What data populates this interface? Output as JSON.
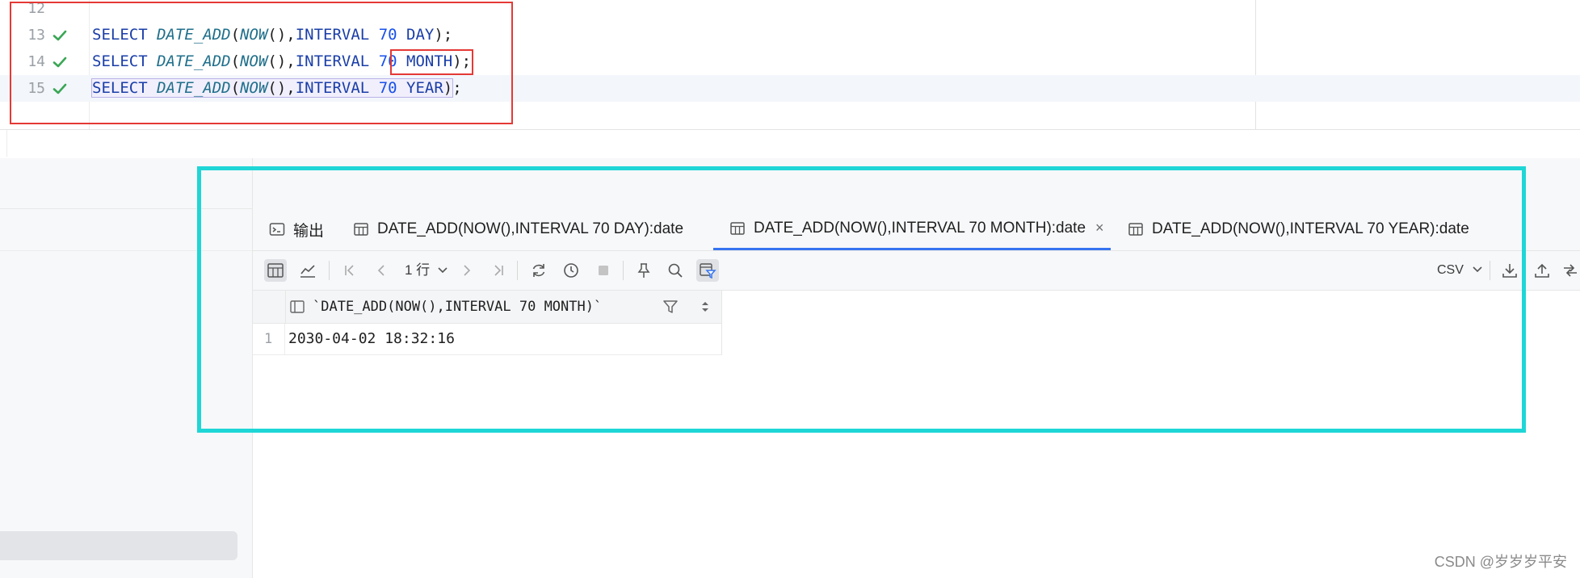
{
  "editor": {
    "lines": [
      {
        "number": "12",
        "status": "",
        "sql": ""
      },
      {
        "number": "13",
        "status": "success",
        "keyword": "SELECT",
        "func": "DATE_ADD",
        "inner": "NOW",
        "interval_kw": "INTERVAL",
        "amount": "70",
        "unit": "DAY"
      },
      {
        "number": "14",
        "status": "success",
        "keyword": "SELECT",
        "func": "DATE_ADD",
        "inner": "NOW",
        "interval_kw": "INTERVAL",
        "amount": "70",
        "unit": "MONTH"
      },
      {
        "number": "15",
        "status": "success",
        "keyword": "SELECT",
        "func": "DATE_ADD",
        "inner": "NOW",
        "interval_kw": "INTERVAL",
        "amount": "70",
        "unit": "YEAR"
      }
    ]
  },
  "results": {
    "tabs": [
      {
        "label": "输出",
        "icon": "console-icon"
      },
      {
        "label": "DATE_ADD(NOW(),INTERVAL 70 DAY):date",
        "icon": "table-icon"
      },
      {
        "label": "DATE_ADD(NOW(),INTERVAL 70 MONTH):date",
        "icon": "table-icon",
        "active": true,
        "closable": "×"
      },
      {
        "label": "DATE_ADD(NOW(),INTERVAL 70 YEAR):date",
        "icon": "table-icon"
      }
    ],
    "toolbar": {
      "rows_selector": "1 行",
      "export_format": "CSV"
    },
    "grid": {
      "column_header": "`DATE_ADD(NOW(),INTERVAL 70 MONTH)`",
      "rows": [
        {
          "row_number": "1",
          "value": "2030-04-02 18:32:16"
        }
      ]
    }
  },
  "annotations": {
    "highlight_colors": {
      "red": "#e53935",
      "cyan": "#1fd6d6"
    }
  },
  "watermark": "CSDN @岁岁岁平安"
}
